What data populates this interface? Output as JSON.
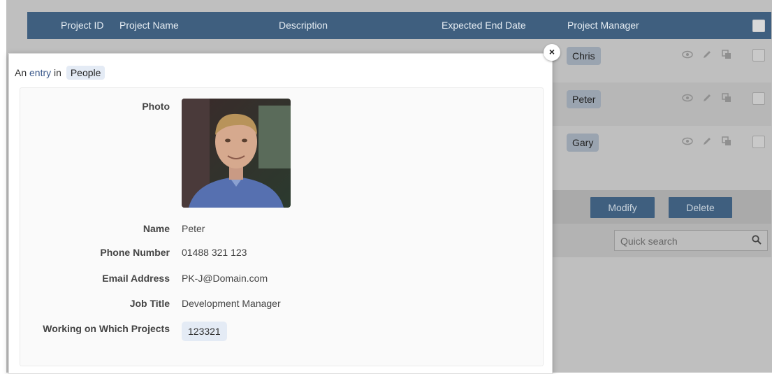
{
  "table": {
    "headers": {
      "project_id": "Project ID",
      "project_name": "Project Name",
      "description": "Description",
      "expected_end_date": "Expected End Date",
      "project_manager": "Project Manager"
    },
    "rows": [
      {
        "project_manager": "Chris"
      },
      {
        "project_manager": "Peter"
      },
      {
        "project_manager": "Gary"
      }
    ],
    "row_icons": [
      "eye-icon",
      "pencil-icon",
      "copy-icon"
    ]
  },
  "actions": {
    "modify_label": "Modify",
    "delete_label": "Delete"
  },
  "search": {
    "placeholder": "Quick search"
  },
  "modal": {
    "close_label": "×",
    "heading_prefix": "An",
    "heading_link": "entry",
    "heading_in": "in",
    "heading_source": "People",
    "fields": {
      "photo_label": "Photo",
      "name_label": "Name",
      "name_value": "Peter",
      "phone_label": "Phone Number",
      "phone_value": "01488 321 123",
      "email_label": "Email Address",
      "email_value": "PK-J@Domain.com",
      "job_label": "Job Title",
      "job_value": "Development Manager",
      "projects_label": "Working on Which Projects",
      "projects_value": "123321"
    }
  },
  "colors": {
    "header_bg": "#3f5f7f",
    "chip_bg": "#e4ebf5",
    "overlay_bg": "#bfbfbf"
  }
}
